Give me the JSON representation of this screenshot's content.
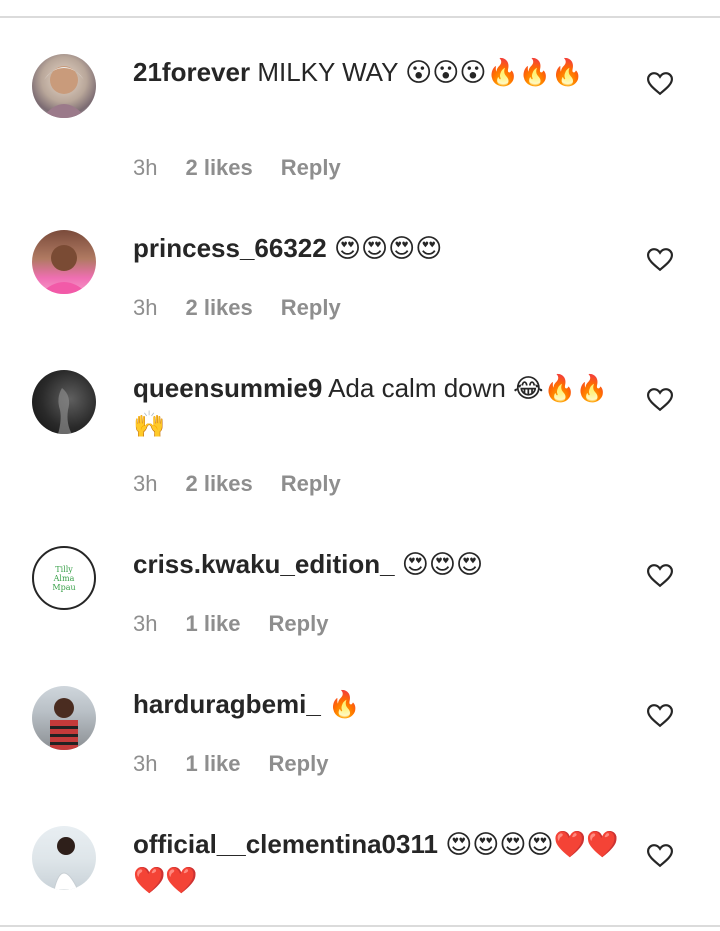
{
  "comments": [
    {
      "username": "21forever",
      "text": "MILKY WAY 😮😮😮🔥🔥🔥",
      "time": "3h",
      "likes": "2 likes",
      "reply": "Reply"
    },
    {
      "username": "princess_66322",
      "text": "😍😍😍😍",
      "time": "3h",
      "likes": "2 likes",
      "reply": "Reply"
    },
    {
      "username": "queensummie9",
      "text": "Ada calm down 😂🔥🔥🙌",
      "time": "3h",
      "likes": "2 likes",
      "reply": "Reply"
    },
    {
      "username": "criss.kwaku_edition_",
      "text": "😍😍😍",
      "time": "3h",
      "likes": "1 like",
      "reply": "Reply",
      "avatar_text": "Tilly Alma Mpau"
    },
    {
      "username": "harduragbemi_",
      "text": "🔥",
      "time": "3h",
      "likes": "1 like",
      "reply": "Reply"
    },
    {
      "username": "official__clementina0311",
      "text": "😍😍😍😍❤️❤️❤️❤️",
      "time": "",
      "likes": "",
      "reply": ""
    }
  ],
  "colors": {
    "text": "#262626",
    "meta": "#8e8e8e",
    "divider": "#dbdbdb",
    "heart_stroke": "#262626"
  }
}
